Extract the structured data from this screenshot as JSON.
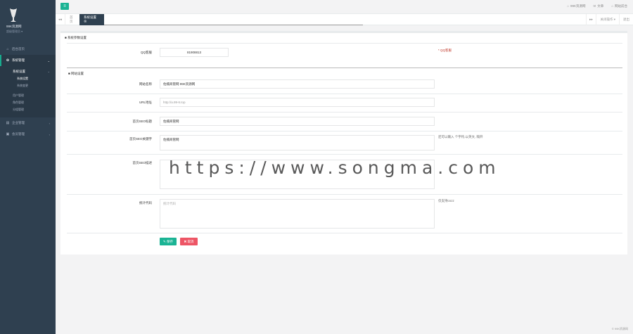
{
  "profile": {
    "name": "99K资源网",
    "role": "超级管理员 ▾"
  },
  "sidebar": {
    "items": [
      {
        "icon": "home-icon",
        "glyph": "⌂",
        "label": "后台首页"
      },
      {
        "icon": "gear-icon",
        "glyph": "✿",
        "label": "系统管理"
      },
      {
        "icon": "box-icon",
        "glyph": "▤",
        "label": "企业管理"
      },
      {
        "icon": "user-icon",
        "glyph": "▣",
        "label": "会员管理"
      }
    ],
    "sub_group": "系统设置",
    "sub_items": [
      "系统设置",
      "系统变更"
    ],
    "sub_items2": [
      "用户管理",
      "角色管理",
      "分组管理"
    ]
  },
  "topbar": {
    "menu_glyph": "≡",
    "links": [
      {
        "icon": "home-icon",
        "glyph": "⌂",
        "label": "99K资源网"
      },
      {
        "icon": "mail-icon",
        "glyph": "✉",
        "label": "文章"
      },
      {
        "icon": "home-icon",
        "glyph": "⌂",
        "label": "网站前台"
      }
    ]
  },
  "tabs": {
    "home": "首页",
    "active": "系统设置 ⊗",
    "left_arrow": "◂◂",
    "right_arrow": "▸▸",
    "actions": [
      "关闭操作 ▾",
      "退出"
    ]
  },
  "form": {
    "section1": "■ 系统参数设置",
    "qq_label": "QQ客服",
    "qq_value": "81908813",
    "qq_hint": "* QQ客服",
    "section2": "■ 网站设置",
    "site_name_label": "网站名称",
    "site_name_value": "佐楠商管网 99K资源网",
    "url_label": "URL地址",
    "url_placeholder": "http://a.99-6.top",
    "seo_title_label": "首页SEO标题",
    "seo_title_value": "佐楠商管网",
    "seo_kw_label": "首页SEO关键字",
    "seo_kw_value": "佐楠商管网",
    "seo_kw_hint": "还可以输入 个字符,以英文, 隔开",
    "seo_desc_label": "首页SEO描述",
    "seo_desc_value": "",
    "stat_label": "统计代码",
    "stat_placeholder": "统计代码",
    "stat_hint": "仅支持cnzz",
    "save": "✎ 保存",
    "cancel": "✖ 取消"
  },
  "footer": "© 99K资源网",
  "watermark": "https://www.songma.com"
}
